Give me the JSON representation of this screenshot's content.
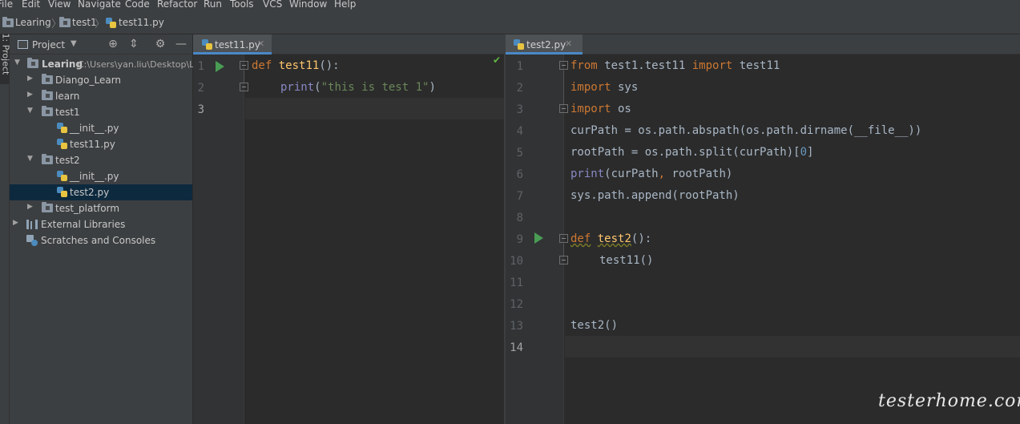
{
  "menu": [
    "File",
    "Edit",
    "View",
    "Navigate",
    "Code",
    "Refactor",
    "Run",
    "Tools",
    "VCS",
    "Window",
    "Help"
  ],
  "breadcrumb": [
    "Learing",
    "test1",
    "test11.py"
  ],
  "toolstrip": {
    "label": "1: Project"
  },
  "project": {
    "title": "Project",
    "tree": [
      {
        "label": "Learing",
        "path": "C:\\Users\\yan.liu\\Desktop\\L"
      },
      {
        "label": "Diango_Learn"
      },
      {
        "label": "learn"
      },
      {
        "label": "test1"
      },
      {
        "label": "__init__.py"
      },
      {
        "label": "test11.py"
      },
      {
        "label": "test2"
      },
      {
        "label": "__init__.py"
      },
      {
        "label": "test2.py"
      },
      {
        "label": "test_platform"
      },
      {
        "label": "External Libraries"
      },
      {
        "label": "Scratches and Consoles"
      }
    ]
  },
  "editor_left": {
    "tab": "test11.py",
    "lines": [
      "1",
      "2",
      "3"
    ],
    "code": {
      "l1_kw": "def",
      "l1_fn": "test11",
      "l1_rest": "():",
      "l2_bi": "print",
      "l2_open": "(",
      "l2_str": "\"this is test 1\"",
      "l2_close": ")"
    }
  },
  "editor_right": {
    "tab": "test2.py",
    "lines": [
      "1",
      "2",
      "3",
      "4",
      "5",
      "6",
      "7",
      "8",
      "9",
      "10",
      "11",
      "12",
      "13",
      "14"
    ],
    "code": {
      "l1_a": "from",
      "l1_b": " test1.test11 ",
      "l1_c": "import",
      "l1_d": " test11",
      "l2_a": "import",
      "l2_b": " sys",
      "l3_a": "import",
      "l3_b": " os",
      "l4": "curPath = os.path.abspath(os.path.dirname(__file__))",
      "l5_a": "rootPath = os.path.split(curPath)[",
      "l5_n": "0",
      "l5_b": "]",
      "l6_a": "print",
      "l6_b": "(curPath",
      "l6_c": ",",
      "l6_d": " rootPath)",
      "l7": "sys.path.append(rootPath)",
      "l9_a": "def",
      "l9_b": "test2",
      "l9_c": "():",
      "l10": "test11()",
      "l13": "test2()"
    }
  },
  "watermark": "testerhome.com"
}
